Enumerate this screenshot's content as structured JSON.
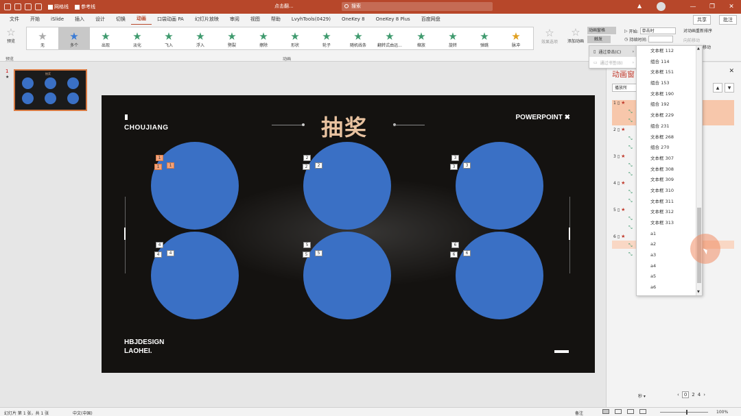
{
  "titlebar": {
    "gridlines_label": "网格线",
    "guides_label": "参考线",
    "doc_title": "点击翻...",
    "search_placeholder": "搜索",
    "minimize": "—",
    "restore": "❐",
    "close": "✕",
    "warning": "▲"
  },
  "menu": {
    "tabs": [
      "文件",
      "开始",
      "iSlide",
      "插入",
      "设计",
      "切换",
      "动画",
      "口袋动画 PA",
      "幻灯片放映",
      "审阅",
      "视图",
      "帮助",
      "LvyhTools(0429)",
      "OneKey 8",
      "OneKey 8 Plus",
      "百度网盘"
    ],
    "active_tab": "动画",
    "share": "共享",
    "comment": "批注"
  },
  "ribbon": {
    "preview_label": "预览",
    "preview_group": "预览",
    "animation_group": "动画",
    "gallery": [
      {
        "label": "无",
        "style": "gray"
      },
      {
        "label": "多个",
        "style": "blue"
      },
      {
        "label": "出现",
        "style": "green"
      },
      {
        "label": "淡化",
        "style": "green"
      },
      {
        "label": "飞入",
        "style": "green"
      },
      {
        "label": "浮入",
        "style": "green"
      },
      {
        "label": "劈裂",
        "style": "green"
      },
      {
        "label": "擦除",
        "style": "green"
      },
      {
        "label": "形状",
        "style": "green"
      },
      {
        "label": "轮子",
        "style": "green"
      },
      {
        "label": "随机线条",
        "style": "green"
      },
      {
        "label": "翻转式由远...",
        "style": "green"
      },
      {
        "label": "缩放",
        "style": "green"
      },
      {
        "label": "旋转",
        "style": "green"
      },
      {
        "label": "弹跳",
        "style": "green"
      },
      {
        "label": "脉冲",
        "style": "gold"
      }
    ],
    "effect_options": "效果选项",
    "add_animation": "添加动画",
    "animation_pane": "动画窗格",
    "trigger": "触发",
    "start_label": "开始:",
    "start_value": "单击时",
    "duration_label": "持续时间:",
    "reorder_title": "对动画重新排序",
    "move_earlier": "向前移动",
    "move_later": "移动"
  },
  "thumbnail": {
    "number": "1",
    "star": "★",
    "title": "抽奖"
  },
  "slide": {
    "left_title": "CHOUJIANG",
    "center_title": "抽奖",
    "right_title": "POWERPOINT ✖",
    "bottom_line1": "HBJDESIGN",
    "bottom_line2": "LAOHEI.",
    "tags": {
      "c1": [
        "1",
        "1",
        "1"
      ],
      "c2": [
        "2",
        "2",
        "2"
      ],
      "c3": [
        "3",
        "3",
        "3"
      ],
      "c4": [
        "4",
        "4",
        "4"
      ],
      "c5": [
        "5",
        "5",
        "5"
      ],
      "c6": [
        "6",
        "6",
        "6"
      ]
    }
  },
  "anim_pane": {
    "title": "动画窗",
    "close": "✕",
    "play": "播放所",
    "item_numbers": [
      "1",
      "2",
      "3",
      "4",
      "5",
      "6"
    ],
    "seconds_label": "秒 ▾",
    "zoom_values": [
      "0",
      "2",
      "4"
    ]
  },
  "context_menu": {
    "items": [
      {
        "label": "通过单击(C)",
        "highlighted": true,
        "disabled": false
      },
      {
        "label": "通过书签(B)",
        "highlighted": false,
        "disabled": true
      }
    ]
  },
  "dropdown": {
    "items": [
      "文本框 112",
      "组合 114",
      "文本框 151",
      "组合 153",
      "文本框 190",
      "组合 192",
      "文本框 229",
      "组合 231",
      "文本框 268",
      "组合 270",
      "文本框 307",
      "文本框 308",
      "文本框 309",
      "文本框 310",
      "文本框 311",
      "文本框 312",
      "文本框 313",
      "a1",
      "a2",
      "a3",
      "a4",
      "a5",
      "a6"
    ]
  },
  "statusbar": {
    "slide_info": "幻灯片 第 1 张，共 1 张",
    "language": "中文(中国)",
    "notes": "备注",
    "zoom": "100%"
  },
  "colors": {
    "brand": "#b7472a",
    "slide_bg": "#141210",
    "circle": "#3a70c5",
    "title_gold": "#e8c2a0",
    "anim_highlight": "#f7c7ab"
  }
}
